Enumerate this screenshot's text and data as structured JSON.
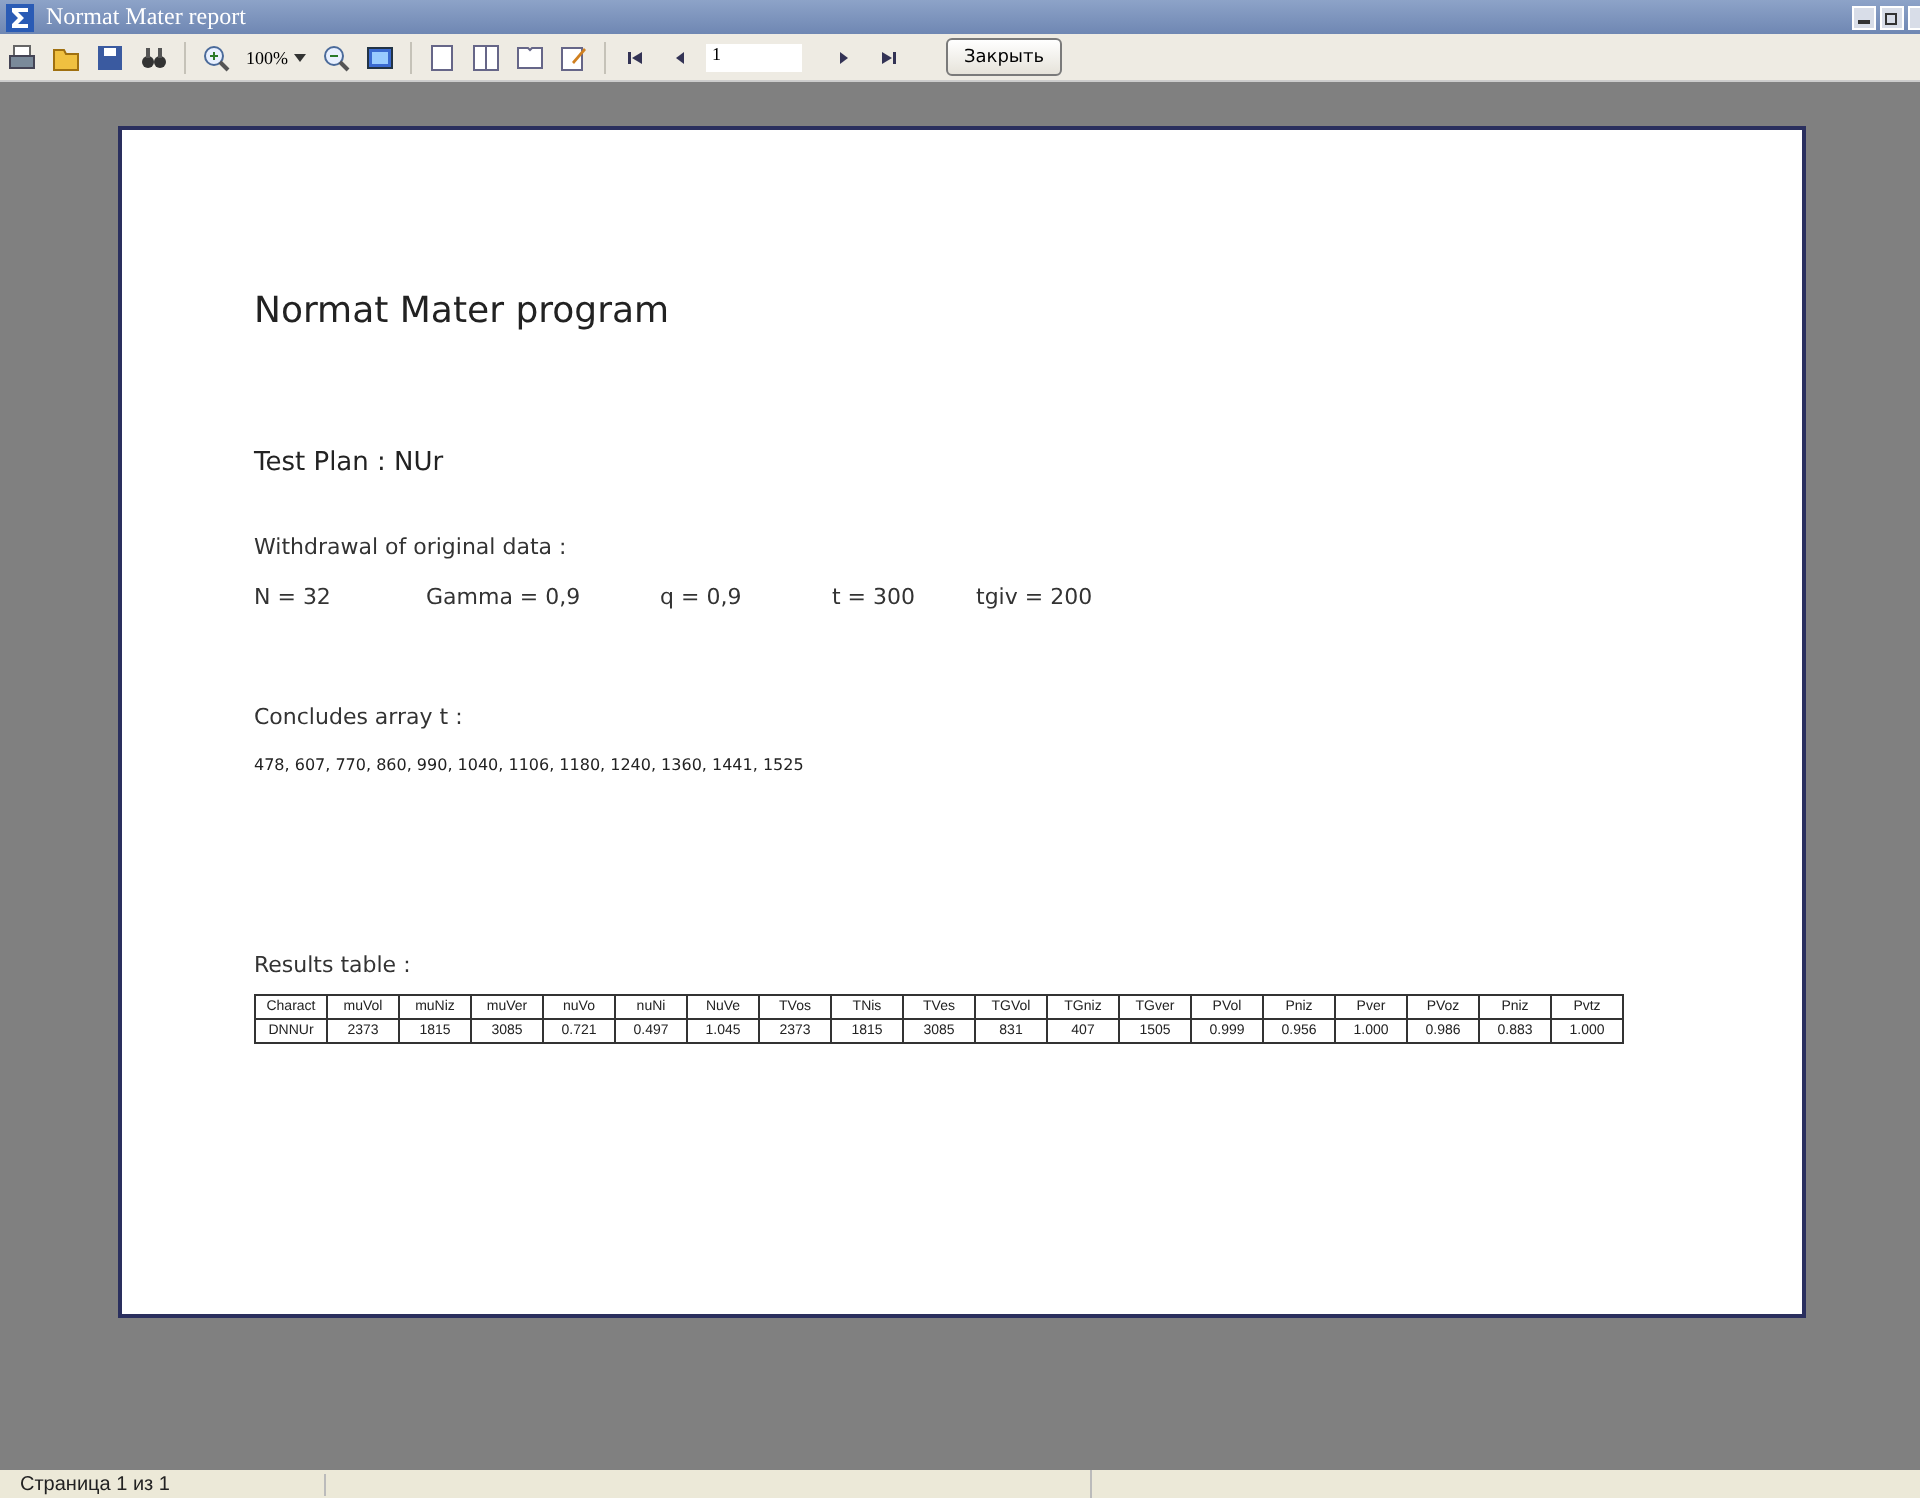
{
  "window": {
    "title": "Normat Mater report"
  },
  "toolbar": {
    "zoom": "100%",
    "page": "1",
    "close_button": "Закрыть"
  },
  "report": {
    "title": "Normat Mater program",
    "test_plan": "Test Plan : NUr",
    "withdrawal_label": "Withdrawal of original data :",
    "parameters": [
      "N = 32",
      "Gamma = 0,9",
      "q = 0,9",
      "t = 300",
      "tgiv = 200"
    ],
    "concludes_label": "Concludes array t :",
    "array": "478, 607, 770, 860, 990, 1040, 1106, 1180, 1240, 1360, 1441, 1525",
    "results_label": "Results table :",
    "table": {
      "columns": [
        "Charact",
        "muVol",
        "muNiz",
        "muVer",
        "nuVo",
        "nuNi",
        "NuVe",
        "TVos",
        "TNis",
        "TVes",
        "TGVol",
        "TGniz",
        "TGver",
        "PVol",
        "Pniz",
        "Pver",
        "PVoz",
        "Pniz",
        "Pvtz"
      ],
      "rows": [
        [
          "DNNUr",
          "2373",
          "1815",
          "3085",
          "0.721",
          "0.497",
          "1.045",
          "2373",
          "1815",
          "3085",
          "831",
          "407",
          "1505",
          "0.999",
          "0.956",
          "1.000",
          "0.986",
          "0.883",
          "1.000"
        ]
      ]
    }
  },
  "status_bar": {
    "page_info": "Страница 1 из 1"
  }
}
